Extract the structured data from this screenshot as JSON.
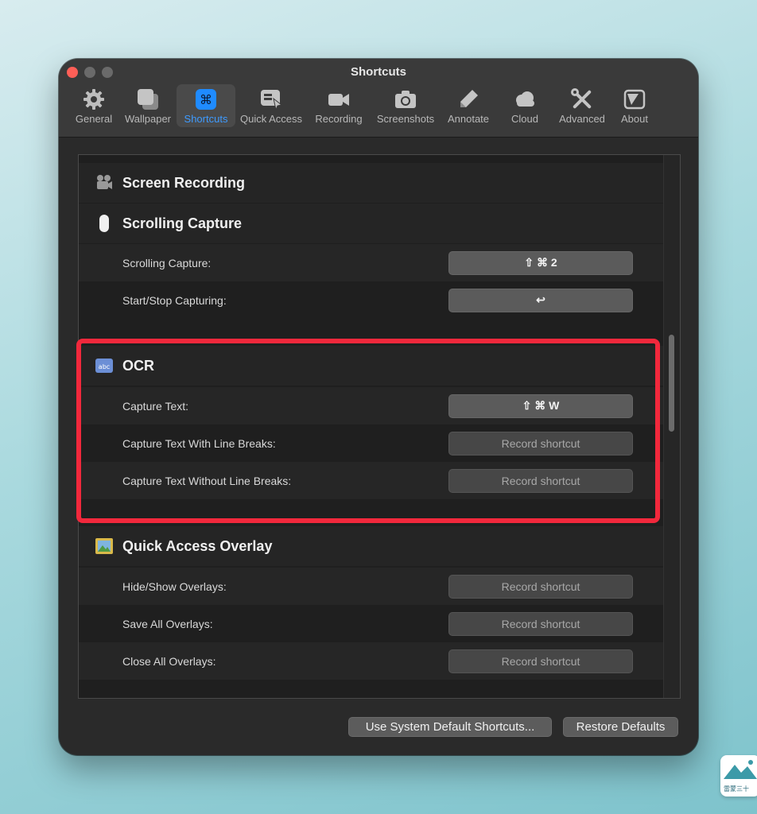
{
  "window": {
    "title": "Shortcuts"
  },
  "toolbar": {
    "items": [
      {
        "label": "General",
        "icon": "gear-icon"
      },
      {
        "label": "Wallpaper",
        "icon": "wallpaper-icon"
      },
      {
        "label": "Shortcuts",
        "icon": "command-icon",
        "active": true
      },
      {
        "label": "Quick Access",
        "icon": "quick-access-icon"
      },
      {
        "label": "Recording",
        "icon": "video-camera-icon"
      },
      {
        "label": "Screenshots",
        "icon": "camera-icon"
      },
      {
        "label": "Annotate",
        "icon": "pen-icon"
      },
      {
        "label": "Cloud",
        "icon": "cloud-icon"
      },
      {
        "label": "Advanced",
        "icon": "tools-icon"
      },
      {
        "label": "About",
        "icon": "about-icon"
      }
    ]
  },
  "sections": {
    "screen_recording": {
      "title": "Screen Recording"
    },
    "scrolling_capture": {
      "title": "Scrolling Capture",
      "rows": [
        {
          "label": "Scrolling Capture:",
          "shortcut": "⇧ ⌘ 2"
        },
        {
          "label": "Start/Stop Capturing:",
          "shortcut": "↩"
        }
      ]
    },
    "ocr": {
      "title": "OCR",
      "rows": [
        {
          "label": "Capture Text:",
          "shortcut": "⇧ ⌘ W"
        },
        {
          "label": "Capture Text With Line Breaks:",
          "shortcut": "Record shortcut"
        },
        {
          "label": "Capture Text Without Line Breaks:",
          "shortcut": "Record shortcut"
        }
      ]
    },
    "quick_access_overlay": {
      "title": "Quick Access Overlay",
      "rows": [
        {
          "label": "Hide/Show Overlays:",
          "shortcut": "Record shortcut"
        },
        {
          "label": "Save All Overlays:",
          "shortcut": "Record shortcut"
        },
        {
          "label": "Close All Overlays:",
          "shortcut": "Record shortcut"
        }
      ]
    }
  },
  "footer": {
    "system_default_label": "Use System Default Shortcuts...",
    "restore_label": "Restore Defaults"
  },
  "watermark": {
    "text": "雷蒙三十"
  },
  "colors": {
    "accent": "#3e9bff",
    "highlight": "#f2283c"
  }
}
